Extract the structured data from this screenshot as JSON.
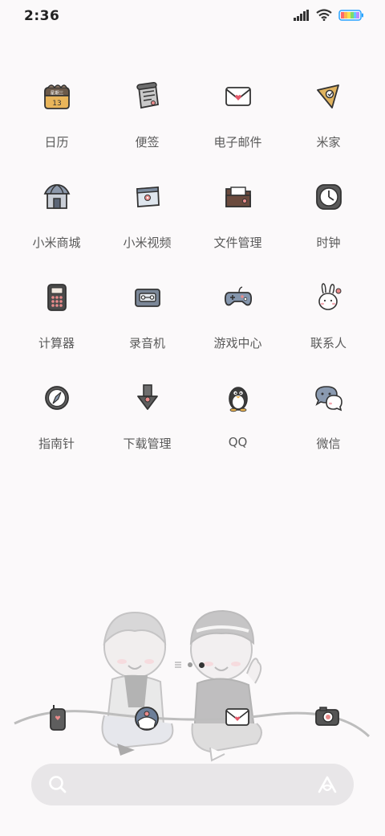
{
  "status_bar": {
    "time": "2:36"
  },
  "apps": [
    {
      "label": "日历",
      "icon": "calendar-icon",
      "calendar_text": "星期三",
      "calendar_day": "13"
    },
    {
      "label": "便签",
      "icon": "notes-icon"
    },
    {
      "label": "电子邮件",
      "icon": "mail-icon"
    },
    {
      "label": "米家",
      "icon": "mijia-icon"
    },
    {
      "label": "小米商城",
      "icon": "store-icon"
    },
    {
      "label": "小米视频",
      "icon": "video-icon"
    },
    {
      "label": "文件管理",
      "icon": "folder-icon"
    },
    {
      "label": "时钟",
      "icon": "clock-icon"
    },
    {
      "label": "计算器",
      "icon": "calculator-icon"
    },
    {
      "label": "录音机",
      "icon": "recorder-icon"
    },
    {
      "label": "游戏中心",
      "icon": "gamepad-icon"
    },
    {
      "label": "联系人",
      "icon": "contacts-icon"
    },
    {
      "label": "指南针",
      "icon": "compass-icon"
    },
    {
      "label": "下载管理",
      "icon": "download-icon"
    },
    {
      "label": "QQ",
      "icon": "qq-penguin-icon"
    },
    {
      "label": "微信",
      "icon": "wechat-icon"
    }
  ],
  "dock": [
    {
      "icon": "phone-icon"
    },
    {
      "icon": "browser-icon"
    },
    {
      "icon": "messages-icon"
    },
    {
      "icon": "camera-icon"
    }
  ],
  "colors": {
    "background": "#fbf9fa",
    "search_bar": "#e8e6e8",
    "icon_outline": "#333333"
  }
}
